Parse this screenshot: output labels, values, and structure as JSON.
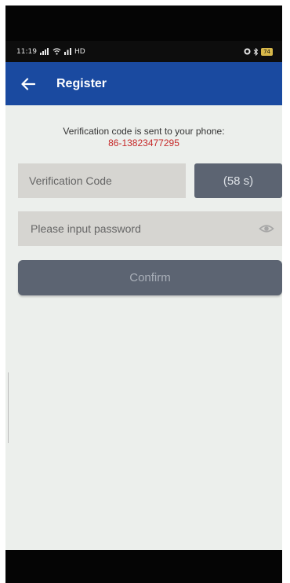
{
  "status_bar": {
    "time": "11:19",
    "signal_text": "HD",
    "battery": "74"
  },
  "header": {
    "title": "Register",
    "color": "#1a4aa0"
  },
  "verification": {
    "message": "Verification code is sent to your phone:",
    "phone": "86-13823477295",
    "phone_color": "#c62828"
  },
  "code_field": {
    "placeholder": "Verification Code",
    "value": ""
  },
  "countdown": {
    "label": "(58 s)"
  },
  "password_field": {
    "placeholder": "Please input password",
    "value": ""
  },
  "confirm": {
    "label": "Confirm"
  },
  "icons": {
    "back": "arrow-left-icon",
    "eye": "eye-icon"
  }
}
